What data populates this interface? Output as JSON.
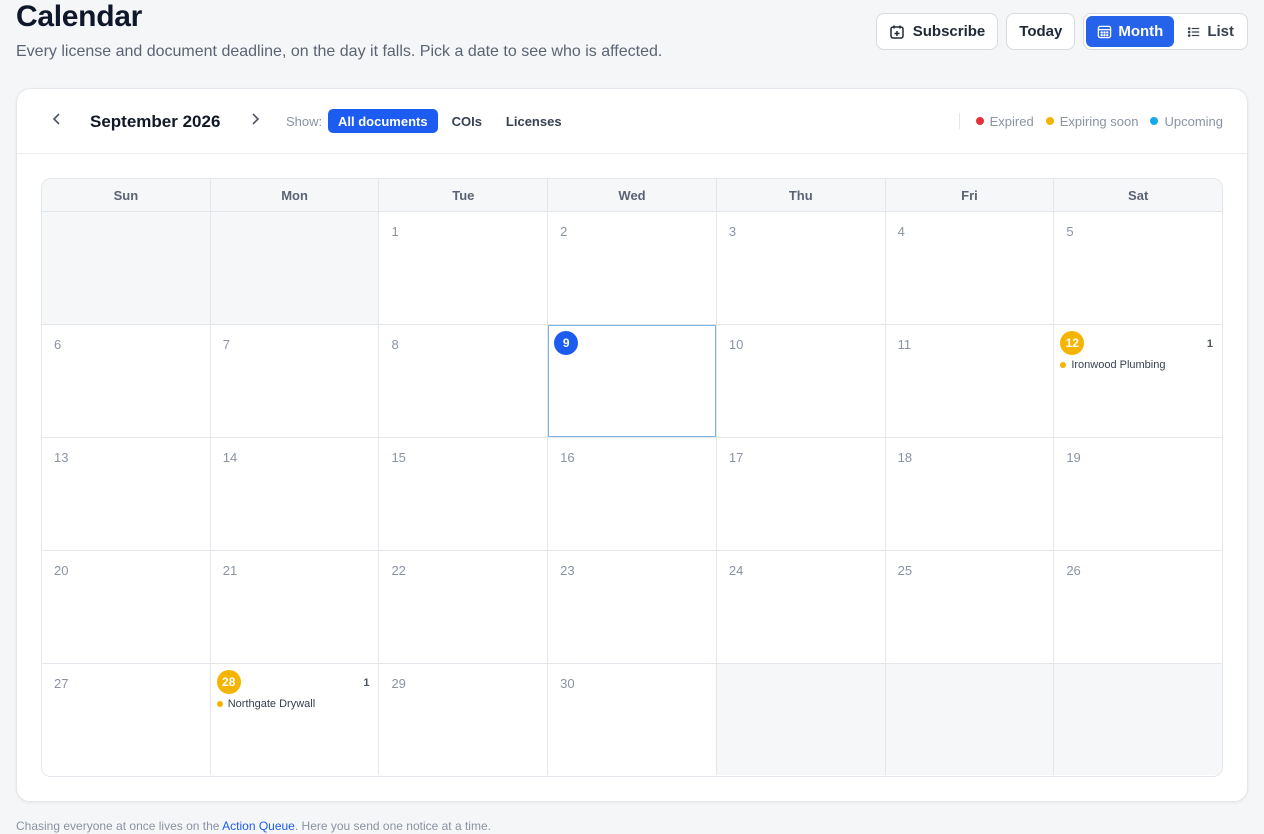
{
  "header": {
    "title": "Calendar",
    "subtitle": "Every license and document deadline, on the day it falls. Pick a date to see who is affected."
  },
  "actions": {
    "subscribe_label": "Subscribe",
    "today_label": "Today",
    "month_label": "Month",
    "list_label": "List"
  },
  "toolbar": {
    "month_label": "September 2026",
    "show_label": "Show:",
    "filters": [
      "All documents",
      "COIs",
      "Licenses"
    ],
    "active_filter": "All documents"
  },
  "legend": [
    {
      "label": "Expired",
      "color": "#e5303b"
    },
    {
      "label": "Expiring soon",
      "color": "#f5b400"
    },
    {
      "label": "Upcoming",
      "color": "#14a8e6"
    }
  ],
  "weekdays": [
    "Sun",
    "Mon",
    "Tue",
    "Wed",
    "Thu",
    "Fri",
    "Sat"
  ],
  "weeks": [
    [
      null,
      null,
      "1",
      "2",
      "3",
      "4",
      "5"
    ],
    [
      "6",
      "7",
      "8",
      "9",
      "10",
      "11",
      "12"
    ],
    [
      "13",
      "14",
      "15",
      "16",
      "17",
      "18",
      "19"
    ],
    [
      "20",
      "21",
      "22",
      "23",
      "24",
      "25",
      "26"
    ],
    [
      "27",
      "28",
      "29",
      "30",
      null,
      null,
      null
    ]
  ],
  "today": "9",
  "events": {
    "12": {
      "count": "1",
      "items": [
        {
          "name": "Ironwood Plumbing",
          "color": "#f5b400"
        }
      ]
    },
    "28": {
      "count": "1",
      "items": [
        {
          "name": "Northgate Drywall",
          "color": "#f5b400"
        }
      ]
    }
  },
  "footer": {
    "before": "Chasing everyone at once lives on the ",
    "link": "Action Queue",
    "after": ". Here you send one notice at a time."
  }
}
